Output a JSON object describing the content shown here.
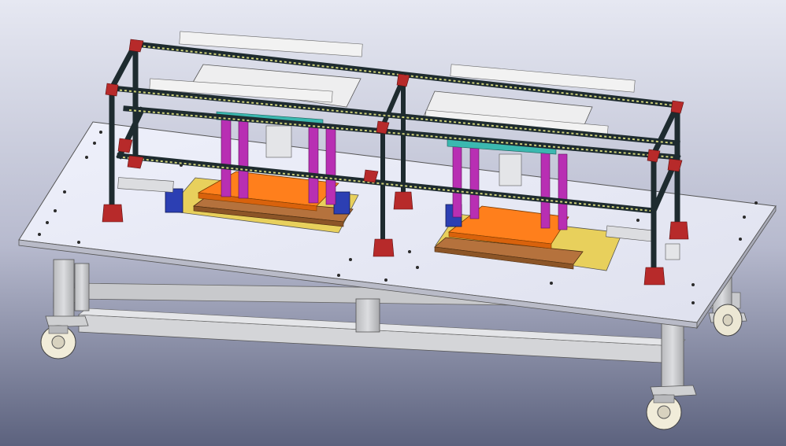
{
  "scene": {
    "background_top": "#e4e6f0",
    "background_bottom": "#5f6580",
    "table_top_color": "#e9ebf7",
    "base_frame_color": "#cfd0d3",
    "upper_frame_color": "#1e2b2f",
    "rail_color": "#cfd27a",
    "bracket_color": "#b72a2a",
    "column_color": "#b82fb3",
    "plate_color": "#ff7f1c",
    "base_plate_color": "#e8d05c",
    "wood_color": "#b5723d",
    "crossbar_color": "#3bb8b0",
    "motor_color": "#2c3fb3",
    "caster_wheel_color": "#f1ecd9",
    "icons": [
      "caster-wheel",
      "press-station"
    ]
  }
}
